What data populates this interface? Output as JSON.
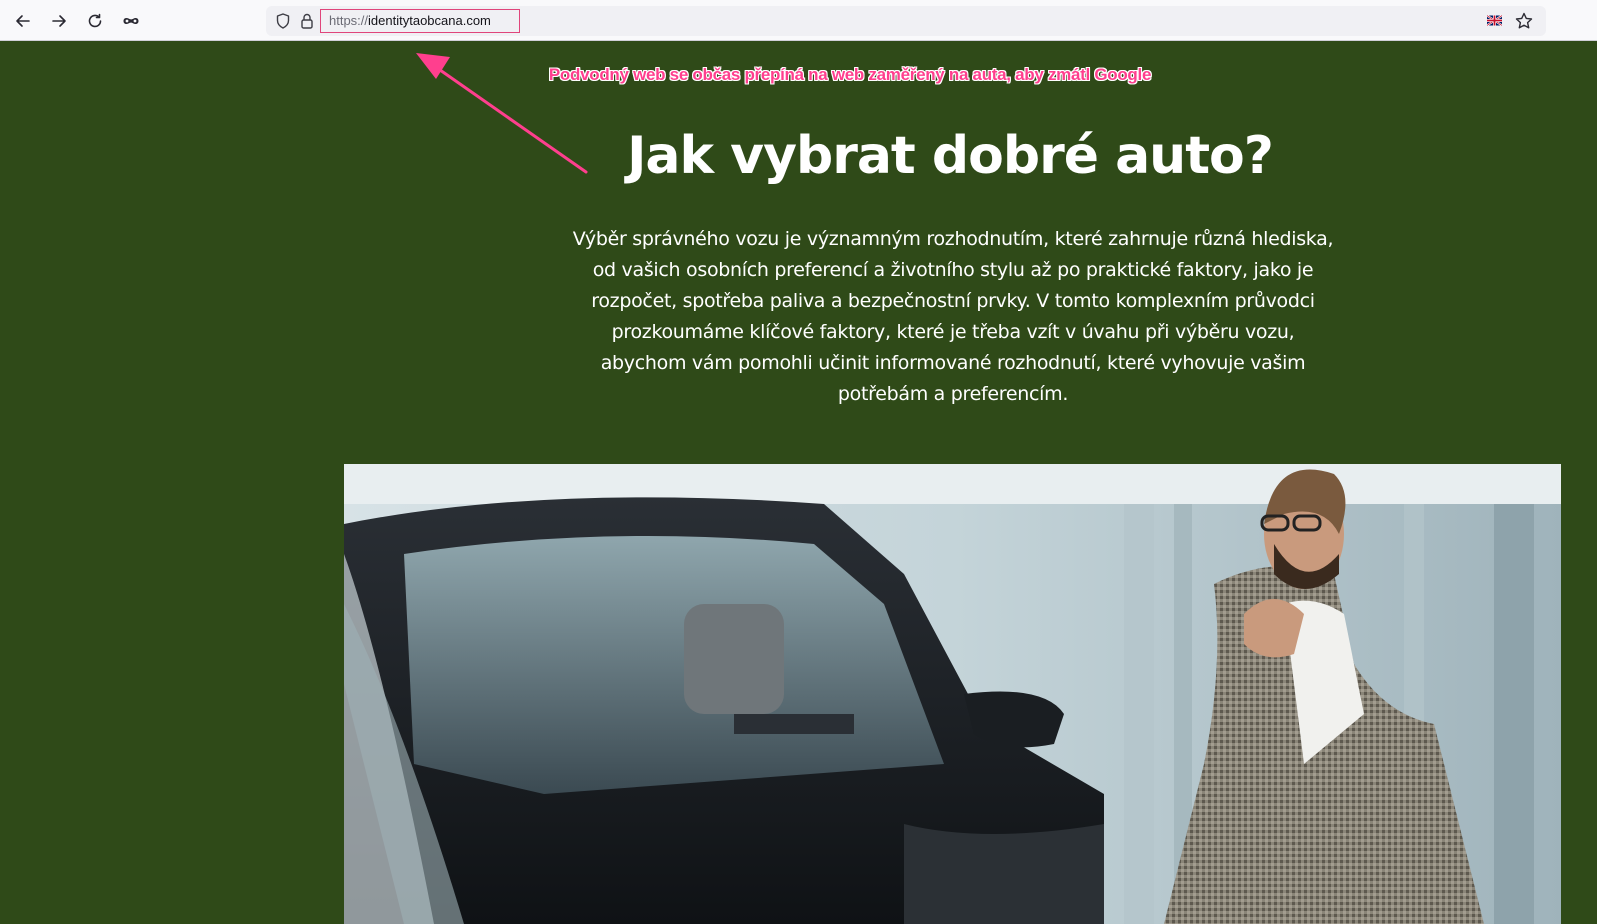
{
  "browser": {
    "url_scheme": "https://",
    "url_host": "identitytaobcana.com",
    "icons": {
      "back": "arrow-left-icon",
      "forward": "arrow-right-icon",
      "reload": "reload-icon",
      "private": "mask-icon",
      "tracking": "shield-icon",
      "secure": "lock-icon",
      "translate": "uk-flag-icon",
      "bookmark": "star-icon"
    }
  },
  "annotation": {
    "text": "Podvodný web se občas přepíná na web zaměřený na auta, aby zmátl Google",
    "color": "#ff3f8e"
  },
  "page": {
    "background": "#2f4a18",
    "title": "Jak vybrat dobré auto?",
    "intro": "Výběr správného vozu je významným rozhodnutím, které zahrnuje různá hlediska, od vašich osobních preferencí a životního stylu až po praktické faktory, jako je rozpočet, spotřeba paliva a bezpečnostní prvky. V tomto komplexním průvodci prozkoumáme klíčové faktory, které je třeba vzít v úvahu při výběru vozu, abychom vám pomohli učinit informované rozhodnutí, které vyhovuje vašim potřebám a preferencím.",
    "image": "photo-man-looking-at-black-car-in-showroom"
  }
}
